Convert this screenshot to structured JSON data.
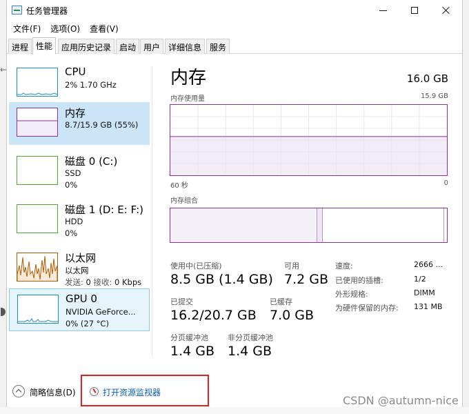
{
  "window": {
    "title": "任务管理器",
    "icon": "task-manager-icon"
  },
  "menu": [
    "文件(F)",
    "选项(O)",
    "查看(V)"
  ],
  "tabs": [
    "进程",
    "性能",
    "应用历史记录",
    "启动",
    "用户",
    "详细信息",
    "服务"
  ],
  "active_tab": "性能",
  "sidebar": {
    "items": [
      {
        "name": "CPU",
        "line1": "2% 1.70 GHz",
        "line2": "",
        "color": "#1a8cc4"
      },
      {
        "name": "内存",
        "line1": "8.7/15.9 GB (55%)",
        "line2": "",
        "color": "#8b2e9e",
        "selected": true
      },
      {
        "name": "磁盘 0 (C:)",
        "line1": "SSD",
        "line2": "0%",
        "color": "#4ca82a"
      },
      {
        "name": "磁盘 1 (D: E: F:)",
        "line1": "HDD",
        "line2": "0%",
        "color": "#4ca82a"
      },
      {
        "name": "以太网",
        "line1": "以太网",
        "line2_send_label": "发送:",
        "line2_send": "0",
        "line2_recv_label": "接收:",
        "line2_recv": "0 Kbps",
        "color": "#b25a00"
      },
      {
        "name": "GPU 0",
        "line1": "NVIDIA GeForce...",
        "line2": "0% (27 °C)",
        "color": "#1a8cc4"
      }
    ]
  },
  "memory": {
    "title": "内存",
    "total": "16.0 GB",
    "usage_label": "内存使用量",
    "usage_max": "15.9 GB",
    "time_left": "60 秒",
    "time_right": "0",
    "usage_fraction": 0.55,
    "composition_label": "内存组合",
    "composition": {
      "in_use": 0.53,
      "modified": 0.02,
      "standby": 0.44
    },
    "stats": {
      "in_use_label": "使用中(已压缩)",
      "in_use_value": "8.5 GB (1.4 GB)",
      "available_label": "可用",
      "available_value": "7.2 GB",
      "committed_label": "已提交",
      "committed_value": "16.2/20.7 GB",
      "cached_label": "已缓存",
      "cached_value": "7.0 GB",
      "paged_label": "分页缓冲池",
      "paged_value": "1.4 GB",
      "nonpaged_label": "非分页缓冲池",
      "nonpaged_value": "1.4 GB"
    },
    "specs": [
      {
        "k": "速度:",
        "v": "2666 ..."
      },
      {
        "k": "已使用的插槽:",
        "v": "1/2"
      },
      {
        "k": "外形规格:",
        "v": "DIMM"
      },
      {
        "k": "为硬件保留的内存:",
        "v": "131 MB"
      }
    ]
  },
  "footer": {
    "fewer_details": "简略信息(D)",
    "open_resource_monitor": "打开资源监视器"
  },
  "watermark": "CSDN @autumn-nice",
  "colors": {
    "memory": "#8b2e9e",
    "memory_fill": "#f2ecf6",
    "highlight": "#cce4f7",
    "annotation": "#e02020",
    "link": "#0a5fb4"
  }
}
